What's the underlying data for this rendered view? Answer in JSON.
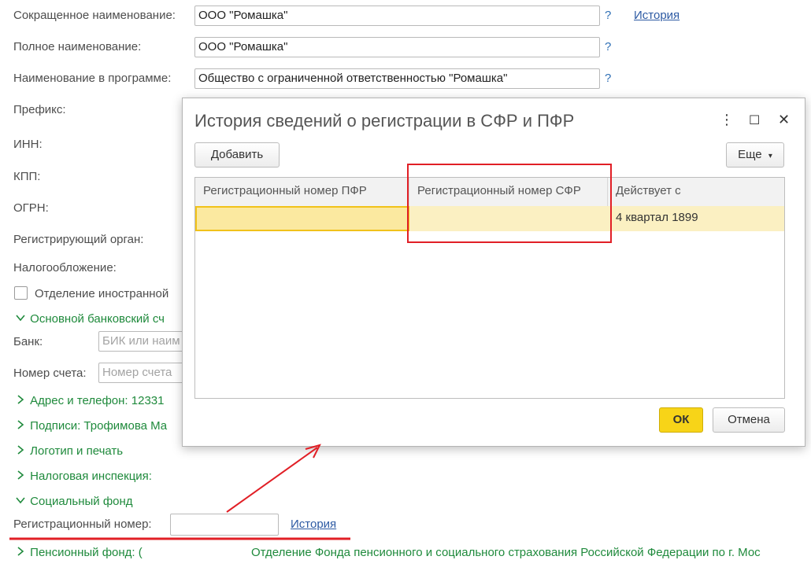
{
  "form": {
    "short_name_label": "Сокращенное наименование:",
    "short_name_value": "ООО \"Ромашка\"",
    "full_name_label": "Полное наименование:",
    "full_name_value": "ООО \"Ромашка\"",
    "program_name_label": "Наименование в программе:",
    "program_name_value": "Общество с ограниченной ответственностью \"Ромашка\"",
    "help_mark": "?",
    "history_link": "История",
    "prefix_label": "Префикс:",
    "inn_label": "ИНН:",
    "kpp_label": "КПП:",
    "ogrn_label": "ОГРН:",
    "reg_authority_label": "Регистрирующий орган:",
    "taxation_label": "Налогообложение:",
    "foreign_branch_label": "Отделение иностранной",
    "bank_account_group": "Основной банковский сч",
    "bank_label": "Банк:",
    "bank_placeholder": "БИК или наим",
    "account_label": "Номер счета:",
    "account_placeholder": "Номер счета",
    "address_group": "Адрес и телефон: 12331",
    "signatures_group": "Подписи: Трофимова Ма",
    "logo_group": "Логотип и печать",
    "tax_office_group": "Налоговая инспекция:",
    "social_fund_group": "Социальный фонд",
    "reg_number_label": "Регистрационный номер:",
    "reg_number_value": "",
    "reg_number_history": "История",
    "pension_fund_group": "Пенсионный фонд: (",
    "pension_fund_text": "Отделение Фонда пенсионного и социального страхования Российской Федерации по г. Мос"
  },
  "dialog": {
    "title": "История сведений о регистрации в СФР и ПФР",
    "menu_icon": "⋮",
    "maximize_icon": "☐",
    "close_icon": "✕",
    "add_button": "Добавить",
    "more_button": "Еще",
    "more_arrow": "▾",
    "columns": [
      "Регистрационный номер ПФР",
      "Регистрационный номер СФР",
      "Действует с"
    ],
    "rows": [
      {
        "pfr": "",
        "sfr": "",
        "since": "4 квартал 1899"
      }
    ],
    "ok_button": "ОК",
    "cancel_button": "Отмена"
  },
  "colors": {
    "accent_green": "#1f8a3c",
    "link_blue": "#2d5aa3",
    "ok_yellow": "#f7d418",
    "annotation_red": "#e11f26"
  }
}
